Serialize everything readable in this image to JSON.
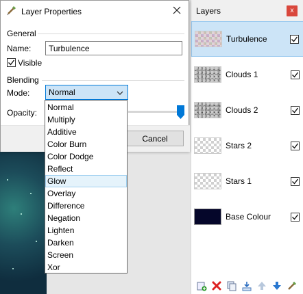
{
  "dialog": {
    "title": "Layer Properties",
    "close_glyph": "✕",
    "general_section": "General",
    "name_label": "Name:",
    "name_value": "Turbulence",
    "visible_label": "Visible",
    "visible_checked": true,
    "blending_section": "Blending",
    "mode_label": "Mode:",
    "mode_value": "Normal",
    "opacity_label": "Opacity:",
    "opacity_value": 100,
    "cancel_label": "Cancel"
  },
  "mode_options": [
    "Normal",
    "Multiply",
    "Additive",
    "Color Burn",
    "Color Dodge",
    "Reflect",
    "Glow",
    "Overlay",
    "Difference",
    "Negation",
    "Lighten",
    "Darken",
    "Screen",
    "Xor"
  ],
  "mode_hovered": "Glow",
  "layers_panel": {
    "title": "Layers",
    "close_glyph": "x",
    "layers": [
      {
        "name": "Turbulence",
        "visible": true,
        "selected": true,
        "thumb": "turbulence"
      },
      {
        "name": "Clouds 1",
        "visible": true,
        "selected": false,
        "thumb": "clouds"
      },
      {
        "name": "Clouds 2",
        "visible": true,
        "selected": false,
        "thumb": "clouds"
      },
      {
        "name": "Stars 2",
        "visible": true,
        "selected": false,
        "thumb": "transparent"
      },
      {
        "name": "Stars 1",
        "visible": true,
        "selected": false,
        "thumb": "transparent"
      },
      {
        "name": "Base Colour",
        "visible": true,
        "selected": false,
        "thumb": "navy"
      }
    ],
    "toolbar_icons": [
      "add-layer-icon",
      "delete-layer-icon",
      "duplicate-layer-icon",
      "merge-down-icon",
      "move-up-icon",
      "move-down-icon",
      "layer-properties-icon"
    ]
  },
  "colors": {
    "accent": "#0078d7",
    "selection": "#cce4f7",
    "close_red": "#d9473c",
    "base_colour": "#05062a"
  }
}
